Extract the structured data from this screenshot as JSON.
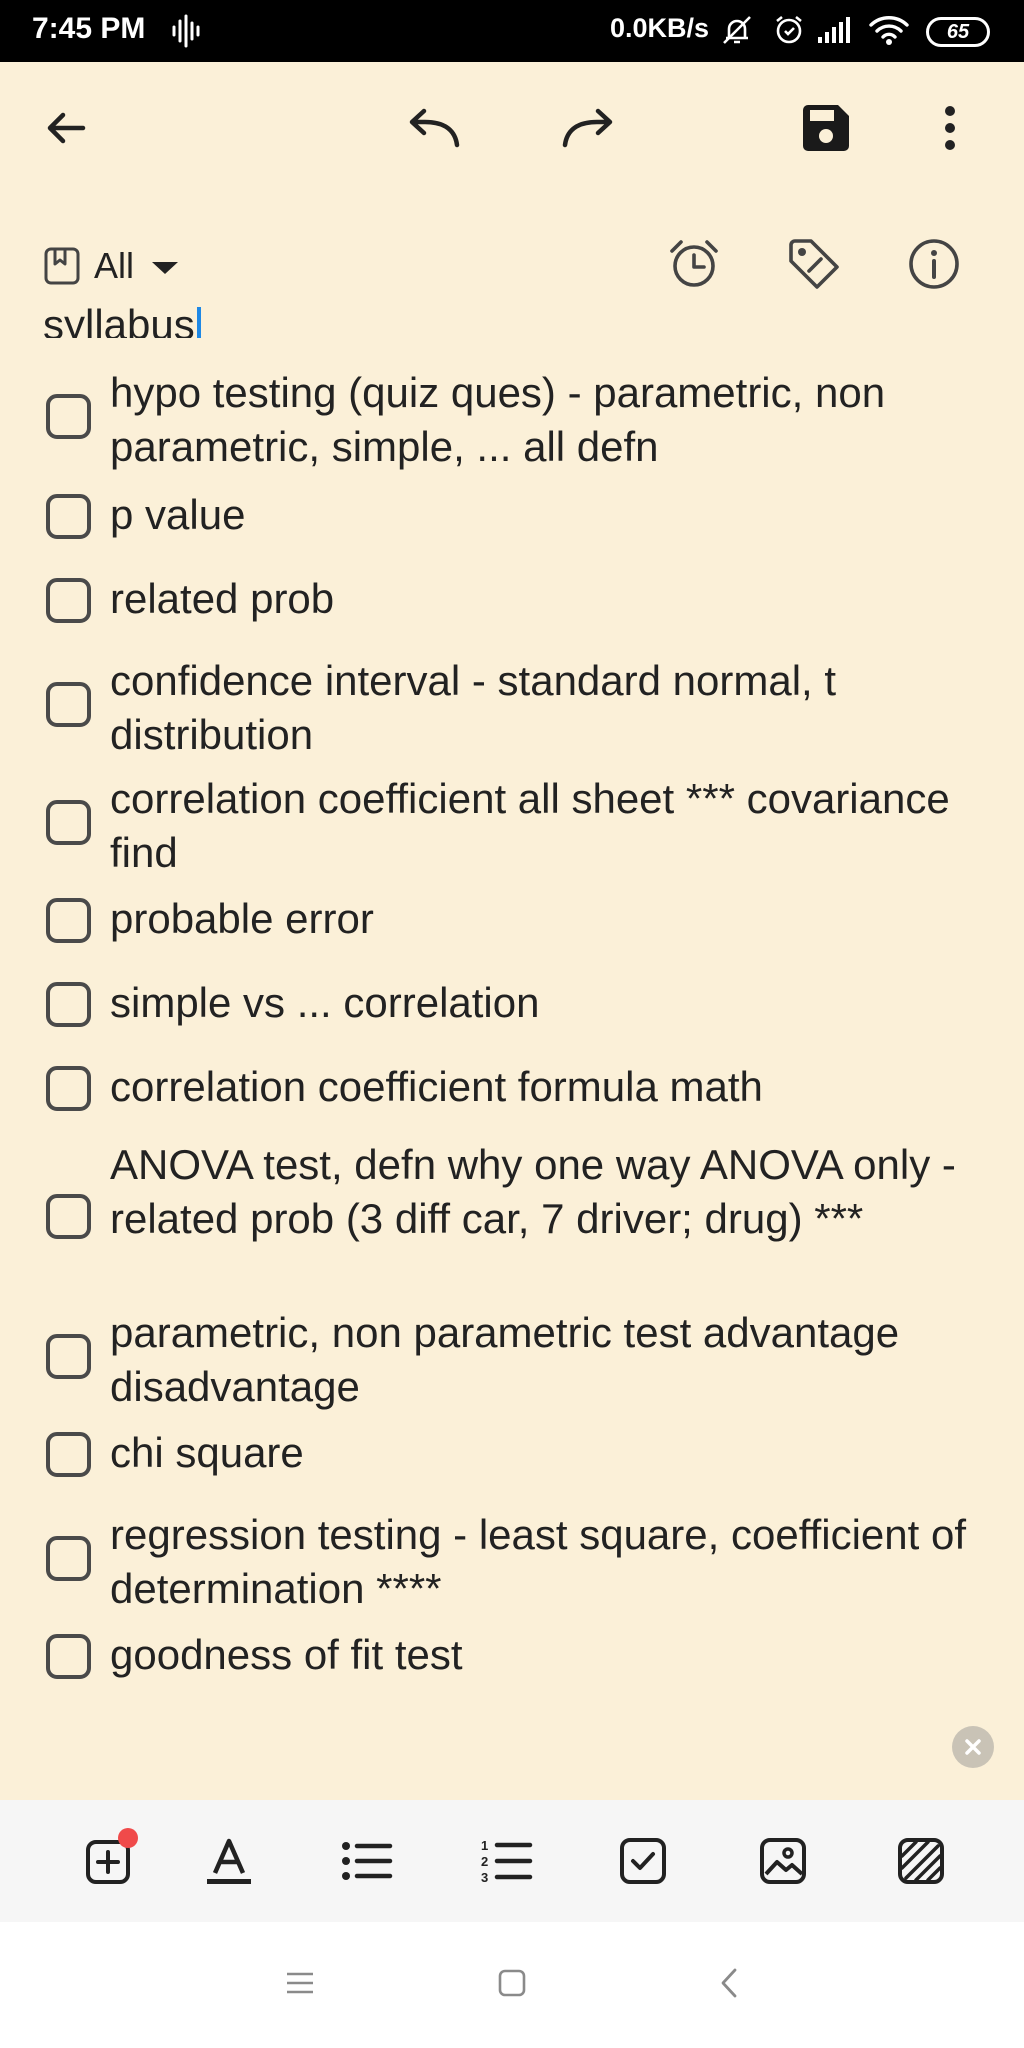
{
  "status_bar": {
    "time": "7:45 PM",
    "speed": "0.0KB/s",
    "battery": "65"
  },
  "toolbar_top": {
    "icons": [
      "back-arrow-icon",
      "undo-icon",
      "redo-icon",
      "save-icon",
      "more-vert-icon"
    ]
  },
  "folder": {
    "label": "All"
  },
  "note": {
    "heading": "syllabus",
    "items": [
      {
        "text": "hypo testing (quiz ques) - parametric, non parametric, simple, ... all defn",
        "checked": false
      },
      {
        "text": "p value",
        "checked": false
      },
      {
        "text": "related prob",
        "checked": false
      },
      {
        "text": "confidence interval - standard normal, t distribution",
        "checked": false
      },
      {
        "text": "correlation coefficient all sheet *** covariance find",
        "checked": false
      },
      {
        "text": "probable error",
        "checked": false
      },
      {
        "text": "simple vs ... correlation",
        "checked": false
      },
      {
        "text": "correlation coefficient formula math",
        "checked": false
      },
      {
        "text": "ANOVA test, defn why one way ANOVA only - related prob (3 diff car, 7 driver; drug) ***",
        "checked": false
      },
      {
        "text": "parametric, non parametric test advantage disadvantage",
        "checked": false
      },
      {
        "text": "chi square",
        "checked": false
      },
      {
        "text": "regression testing - least square, coefficient of determination  ****",
        "checked": false
      },
      {
        "text": "goodness of fit test",
        "checked": false
      }
    ]
  },
  "bottom_toolbar": {
    "icons": [
      "add-box-icon",
      "text-format-icon",
      "bulleted-list-icon",
      "numbered-list-icon",
      "checkbox-icon",
      "image-icon",
      "texture-icon"
    ]
  },
  "colors": {
    "background": "#fbf0d8",
    "cursor": "#1e88e5",
    "badge": "#f04a4a"
  }
}
